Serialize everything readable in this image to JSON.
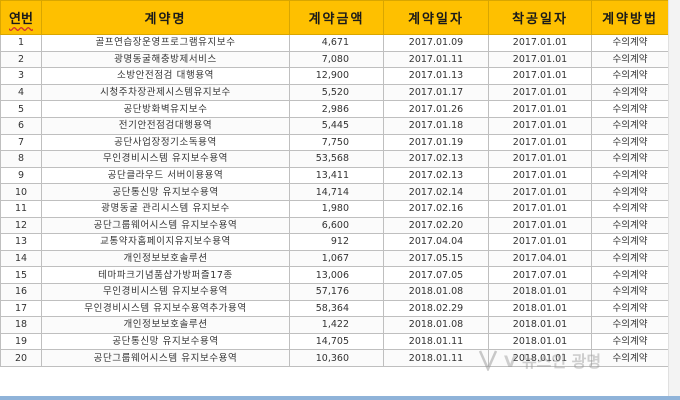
{
  "table": {
    "headers": {
      "no": "연번",
      "name": "계약명",
      "amount": "계약금액",
      "contract_date": "계약일자",
      "start_date": "착공일자",
      "method": "계약방법"
    },
    "rows": [
      {
        "no": "1",
        "name": "골프연습장운영프로그램유지보수",
        "amount": "4,671",
        "contract_date": "2017.01.09",
        "start_date": "2017.01.01",
        "method": "수의계약"
      },
      {
        "no": "2",
        "name": "광명동굴해충방제서비스",
        "amount": "7,080",
        "contract_date": "2017.01.11",
        "start_date": "2017.01.01",
        "method": "수의계약"
      },
      {
        "no": "3",
        "name": "소방안전점검 대행용역",
        "amount": "12,900",
        "contract_date": "2017.01.13",
        "start_date": "2017.01.01",
        "method": "수의계약"
      },
      {
        "no": "4",
        "name": "시청주차장관제시스템유지보수",
        "amount": "5,520",
        "contract_date": "2017.01.17",
        "start_date": "2017.01.01",
        "method": "수의계약"
      },
      {
        "no": "5",
        "name": "공단방화벽유지보수",
        "amount": "2,986",
        "contract_date": "2017.01.26",
        "start_date": "2017.01.01",
        "method": "수의계약"
      },
      {
        "no": "6",
        "name": "전기안전점검대행용역",
        "amount": "5,445",
        "contract_date": "2017.01.18",
        "start_date": "2017.01.01",
        "method": "수의계약"
      },
      {
        "no": "7",
        "name": "공단사업장정기소독용역",
        "amount": "7,750",
        "contract_date": "2017.01.19",
        "start_date": "2017.01.01",
        "method": "수의계약"
      },
      {
        "no": "8",
        "name": "무인경비시스템 유지보수용역",
        "amount": "53,568",
        "contract_date": "2017.02.13",
        "start_date": "2017.01.01",
        "method": "수의계약"
      },
      {
        "no": "9",
        "name": "공단클라우드 서버이용용역",
        "amount": "13,411",
        "contract_date": "2017.02.13",
        "start_date": "2017.01.01",
        "method": "수의계약"
      },
      {
        "no": "10",
        "name": "공단통신망 유지보수용역",
        "amount": "14,714",
        "contract_date": "2017.02.14",
        "start_date": "2017.01.01",
        "method": "수의계약"
      },
      {
        "no": "11",
        "name": "광명동굴 관리시스템 유지보수",
        "amount": "1,980",
        "contract_date": "2017.02.16",
        "start_date": "2017.01.01",
        "method": "수의계약"
      },
      {
        "no": "12",
        "name": "공단그룹웨어시스템 유지보수용역",
        "amount": "6,600",
        "contract_date": "2017.02.20",
        "start_date": "2017.01.01",
        "method": "수의계약"
      },
      {
        "no": "13",
        "name": "교통약자홈페이지유지보수용역",
        "amount": "912",
        "contract_date": "2017.04.04",
        "start_date": "2017.01.01",
        "method": "수의계약"
      },
      {
        "no": "14",
        "name": "개인정보보호솔루션",
        "amount": "1,067",
        "contract_date": "2017.05.15",
        "start_date": "2017.04.01",
        "method": "수의계약"
      },
      {
        "no": "15",
        "name": "테마파크기념품샵가방퍼즐17종",
        "amount": "13,006",
        "contract_date": "2017.07.05",
        "start_date": "2017.07.01",
        "method": "수의계약"
      },
      {
        "no": "16",
        "name": "무인경비시스템 유지보수용역",
        "amount": "57,176",
        "contract_date": "2018.01.08",
        "start_date": "2018.01.01",
        "method": "수의계약"
      },
      {
        "no": "17",
        "name": "무인경비시스템 유지보수용역추가용역",
        "amount": "58,364",
        "contract_date": "2018.02.29",
        "start_date": "2018.01.01",
        "method": "수의계약"
      },
      {
        "no": "18",
        "name": "개인정보보호솔루션",
        "amount": "1,422",
        "contract_date": "2018.01.08",
        "start_date": "2018.01.01",
        "method": "수의계약"
      },
      {
        "no": "19",
        "name": "공단통신망 유지보수용역",
        "amount": "14,705",
        "contract_date": "2018.01.11",
        "start_date": "2018.01.01",
        "method": "수의계약"
      },
      {
        "no": "20",
        "name": "공단그룹웨어시스템 유지보수용역",
        "amount": "10,360",
        "contract_date": "2018.01.11",
        "start_date": "2018.01.01",
        "method": "수의계약"
      }
    ]
  },
  "watermark": {
    "text": "V 뉴스인 광명"
  },
  "colors": {
    "header_bg": "#fec000",
    "border": "#bfbfbf",
    "bottom_bar": "#8fb3d9"
  }
}
